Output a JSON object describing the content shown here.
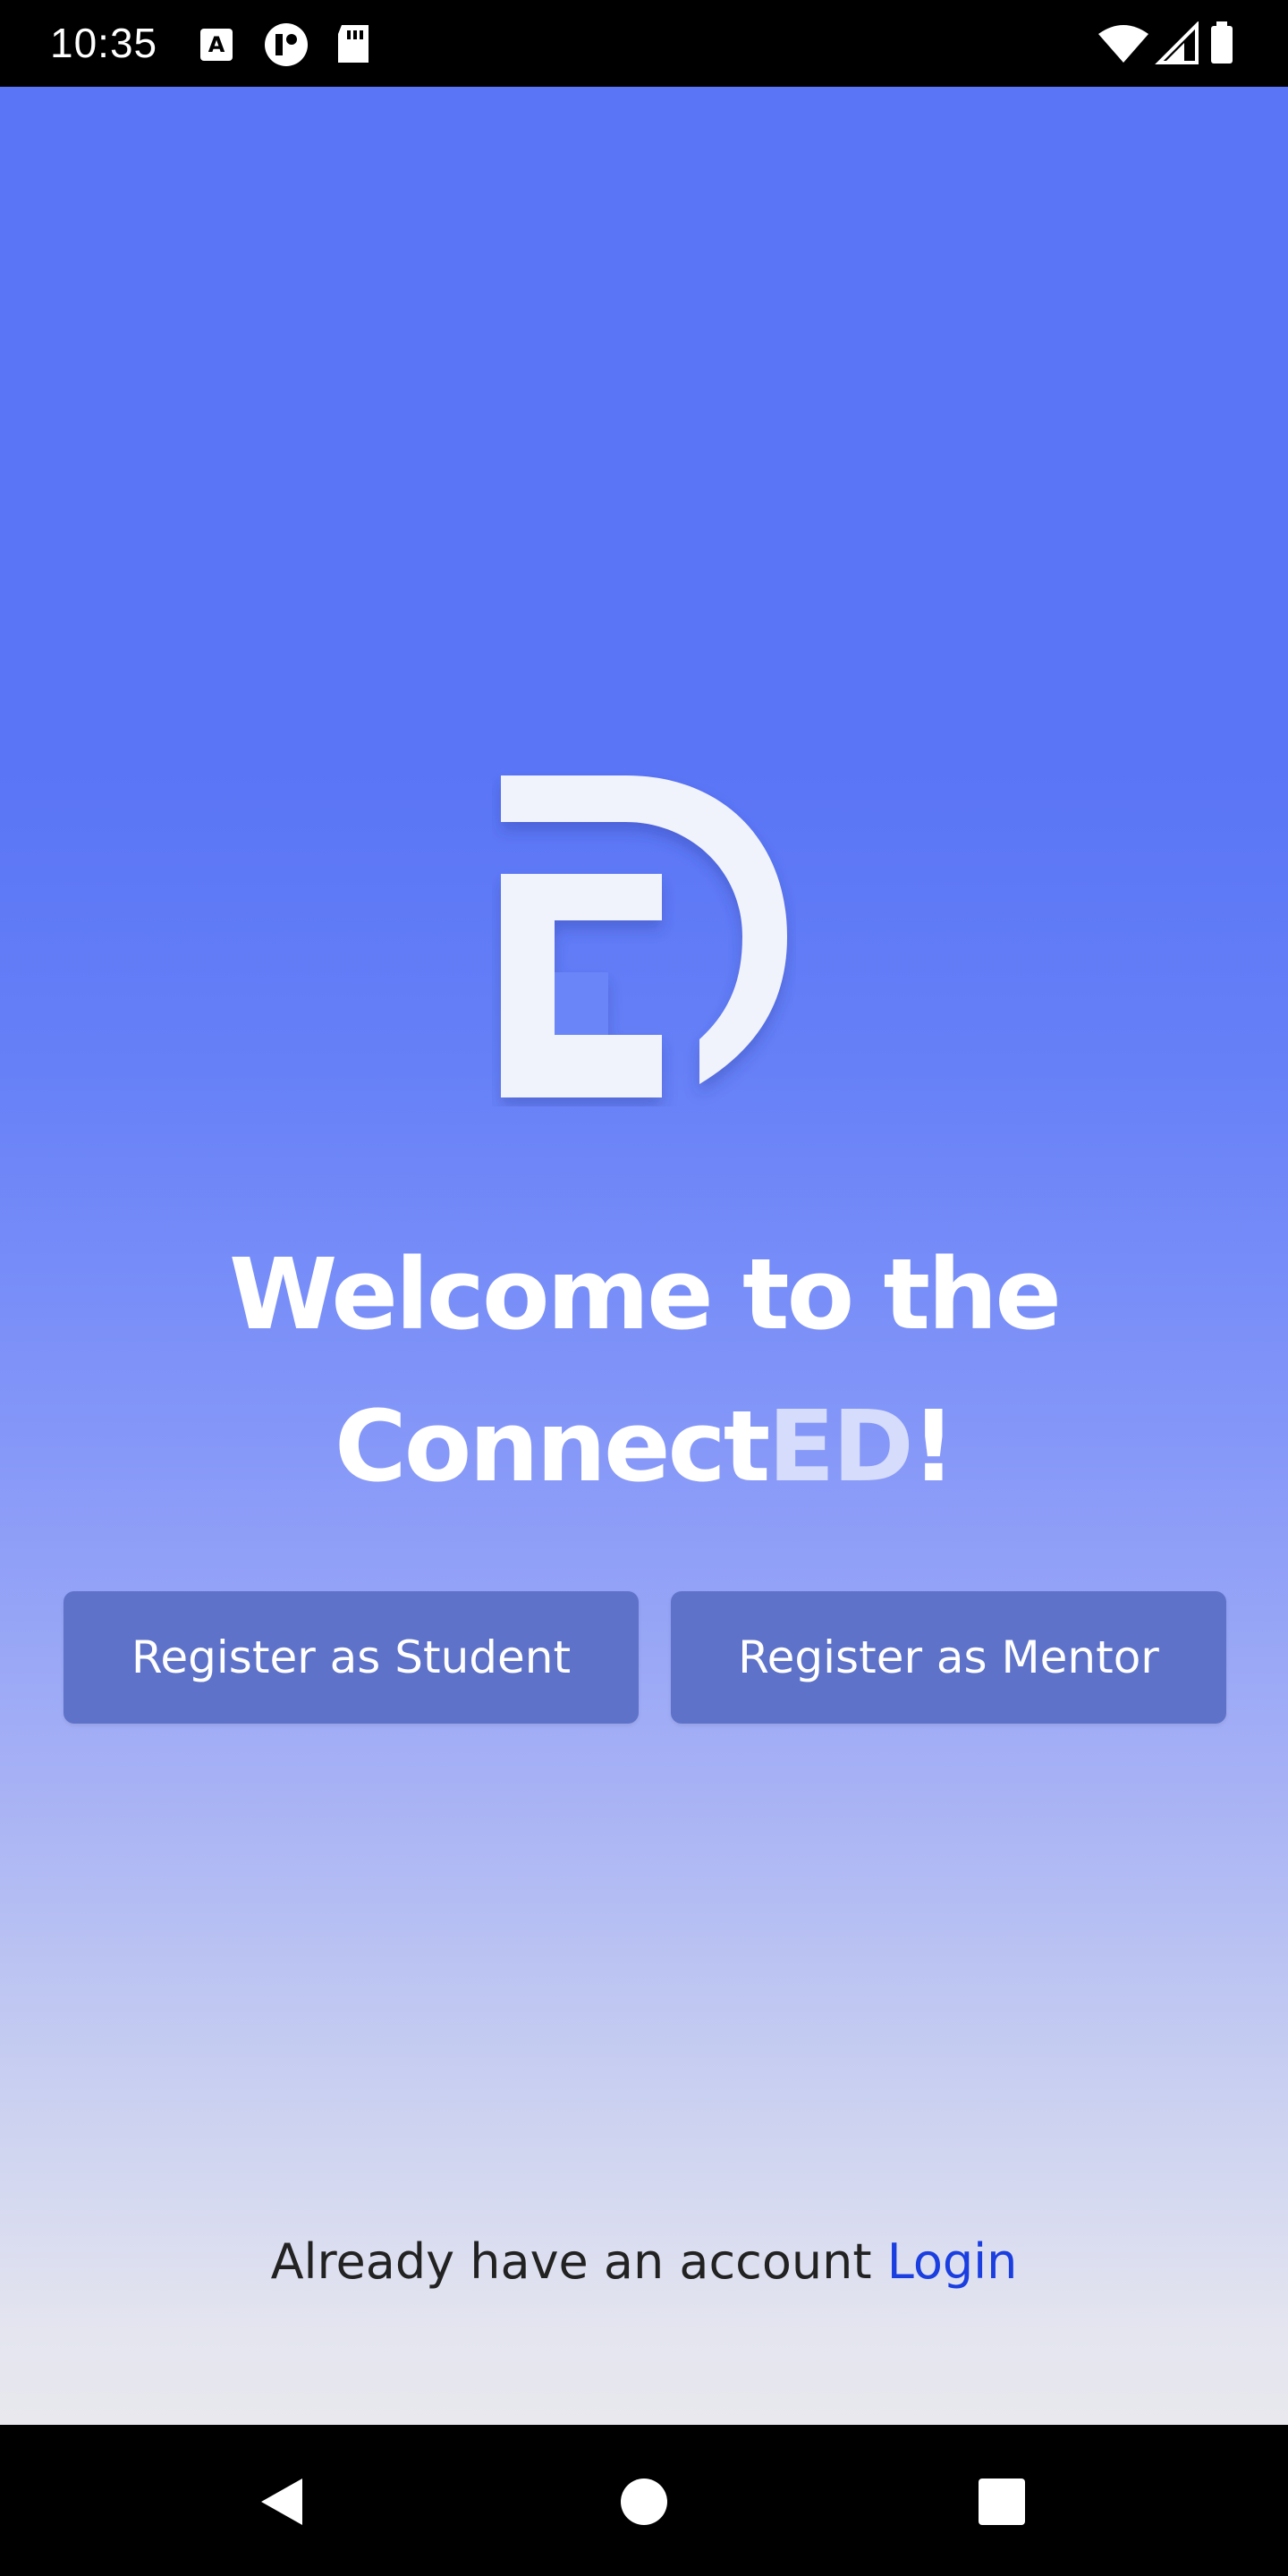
{
  "status_bar": {
    "time": "10:35",
    "left_icons": [
      "a-keyboard-icon",
      "at-icon",
      "sd-card-icon"
    ],
    "right_icons": [
      "wifi-icon",
      "signal-icon",
      "battery-icon"
    ]
  },
  "welcome": {
    "line1": "Welcome to the",
    "line2_prefix": "Connect",
    "line2_brand": "ED",
    "line2_suffix": "!"
  },
  "buttons": {
    "student_label": "Register as Student",
    "mentor_label": "Register as Mentor"
  },
  "login": {
    "prompt": "Already have an account",
    "link": "Login"
  },
  "colors": {
    "gradient_top": "#5a75f6",
    "gradient_bottom": "#e8e8ee",
    "button": "#5e72c9",
    "link": "#1a3ee0"
  },
  "nav_bar": {
    "icons": [
      "back-icon",
      "home-icon",
      "recents-icon"
    ]
  }
}
